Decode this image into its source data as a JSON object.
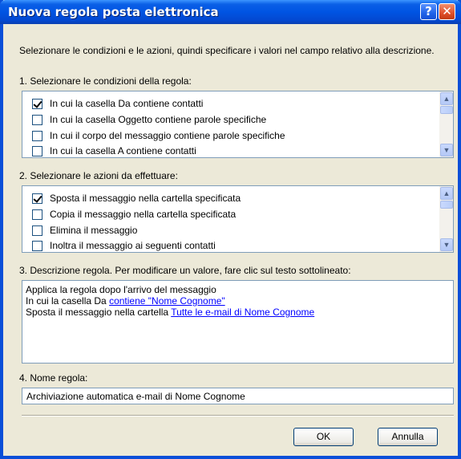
{
  "window": {
    "title": "Nuova regola posta elettronica",
    "help_label": "?",
    "close_label": "✕"
  },
  "intro": "Selezionare le condizioni e le azioni, quindi specificare i valori nel campo relativo alla descrizione.",
  "conditions": {
    "heading": "1. Selezionare le condizioni della regola:",
    "items": [
      {
        "label": "In cui la casella Da contiene contatti",
        "checked": true
      },
      {
        "label": "In cui la casella Oggetto contiene parole specifiche",
        "checked": false
      },
      {
        "label": "In cui il corpo del messaggio contiene parole specifiche",
        "checked": false
      },
      {
        "label": "In cui la casella A contiene contatti",
        "checked": false
      }
    ]
  },
  "actions": {
    "heading": "2. Selezionare le azioni da effettuare:",
    "items": [
      {
        "label": "Sposta il messaggio nella cartella specificata",
        "checked": true
      },
      {
        "label": "Copia il messaggio nella cartella specificata",
        "checked": false
      },
      {
        "label": "Elimina il messaggio",
        "checked": false
      },
      {
        "label": "Inoltra il messaggio ai seguenti contatti",
        "checked": false
      }
    ]
  },
  "description": {
    "heading": "3. Descrizione regola. Per modificare un valore, fare clic sul testo sottolineato:",
    "line1": "Applica la regola dopo l'arrivo del messaggio",
    "line2_prefix": "In cui la casella Da ",
    "line2_link": "contiene \"Nome Cognome\"",
    "line3_prefix": "Sposta il messaggio nella cartella ",
    "line3_link": "Tutte le e-mail di Nome Cognome"
  },
  "rule_name": {
    "heading": "4. Nome regola:",
    "value": "Archiviazione automatica e-mail di Nome Cognome"
  },
  "buttons": {
    "ok": "OK",
    "cancel": "Annulla"
  },
  "colors": {
    "title_bar": "#0054e3",
    "dialog_bg": "#ece9d8",
    "link": "#0000ff"
  }
}
